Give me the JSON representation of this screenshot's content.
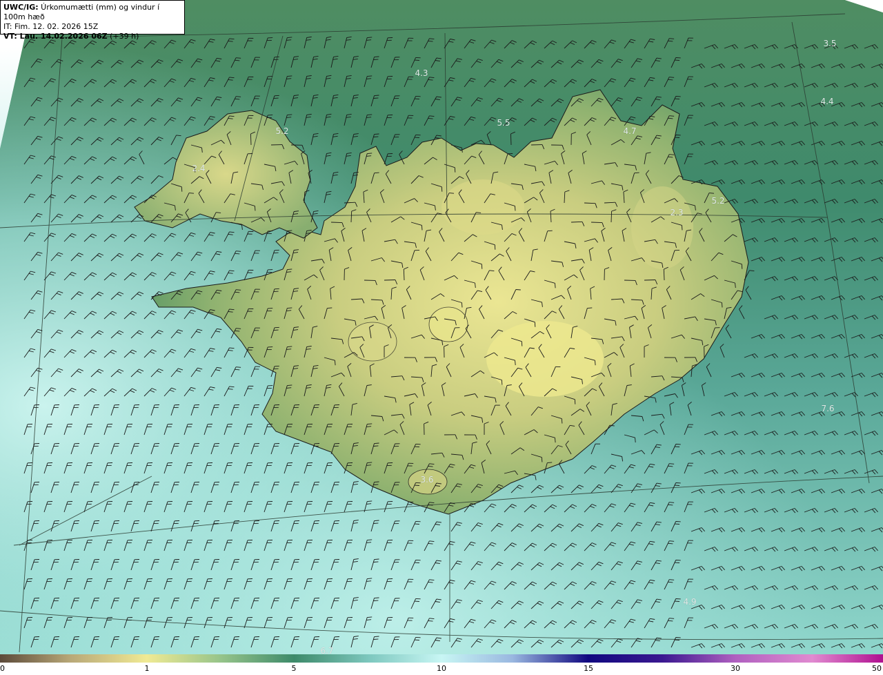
{
  "header": {
    "title_bold": "UWC/IG:",
    "title_rest": " Úrkomumætti (mm) og vindur í 100m hæð",
    "it_line": "IT: Fim. 12. 02. 2026 15Z",
    "vt_bold": "VT: Lau. 14.02.2026 06Z",
    "vt_rest": " (+39 h)"
  },
  "colorbar": {
    "ticks": [
      "0",
      "1",
      "5",
      "10",
      "15",
      "30",
      "50"
    ],
    "colors": [
      "#5c4a3a",
      "#b8a878",
      "#f0ea94",
      "#96c48a",
      "#3d8a6a",
      "#7fc9c0",
      "#c8f6f4",
      "#9ab8e0",
      "#3040a8",
      "#100880",
      "#6a2aa0",
      "#e08ad0",
      "#b01090"
    ]
  },
  "map_labels": {
    "l01": "3.5",
    "l02": "4.3",
    "l03": "4.4",
    "l04": "5.2",
    "l05": "5.5",
    "l06": "4.7",
    "l07": "2.4",
    "l08": "5.2",
    "l09": "2.3",
    "l10": "7.6",
    "l11": "3.6",
    "l12": "4.9",
    "l13": "6.7"
  },
  "colors": {
    "land_highlight": "#e8e58c",
    "land_mid": "#9bb86e",
    "sea_green": "#3f8a6c",
    "sea_cyan": "#a8e6df",
    "coastline": "#1a1a1a"
  }
}
